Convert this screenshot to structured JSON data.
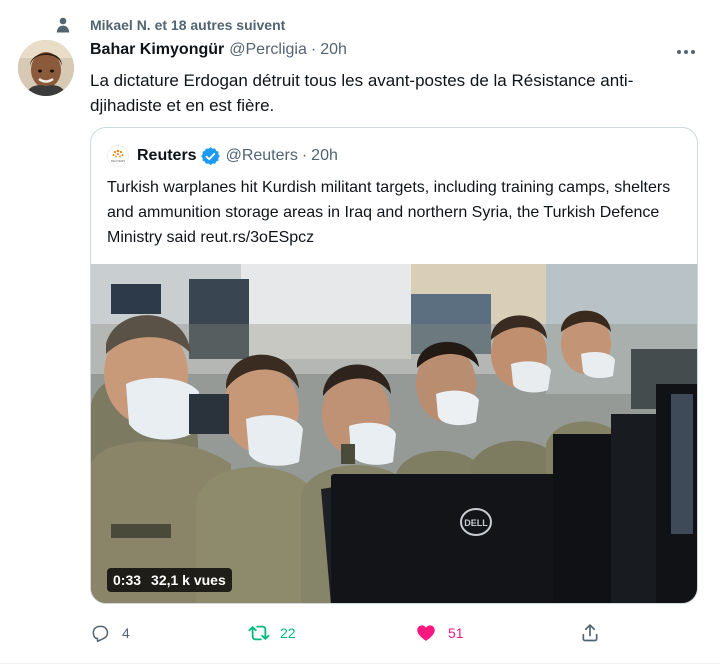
{
  "social_context": {
    "text": "Mikael N. et 18 autres suivent",
    "icon": "person-icon"
  },
  "author": {
    "name": "Bahar Kimyongür",
    "handle": "@Percligia",
    "separator": "·",
    "time": "20h"
  },
  "tweet": {
    "text": "La dictature Erdogan détruit tous les avant-postes de la Résistance anti-djihadiste et en est fière."
  },
  "quote": {
    "author_name": "Reuters",
    "avatar_label": "REUTERS",
    "handle": "@Reuters",
    "separator": "·",
    "time": "20h",
    "text": "Turkish warplanes hit Kurdish militant targets, including training camps, shelters and ammunition storage areas in Iraq and northern Syria, the Turkish Defence Ministry said reut.rs/3oESpcz",
    "video": {
      "duration": "0:33",
      "views": "32,1 k vues"
    },
    "media_logo": "DELL"
  },
  "actions": {
    "replies": "4",
    "retweets": "22",
    "likes": "51"
  },
  "colors": {
    "retweet": "#00ba7c",
    "like": "#f91880",
    "muted": "#536471",
    "verified": "#1d9bf0"
  }
}
